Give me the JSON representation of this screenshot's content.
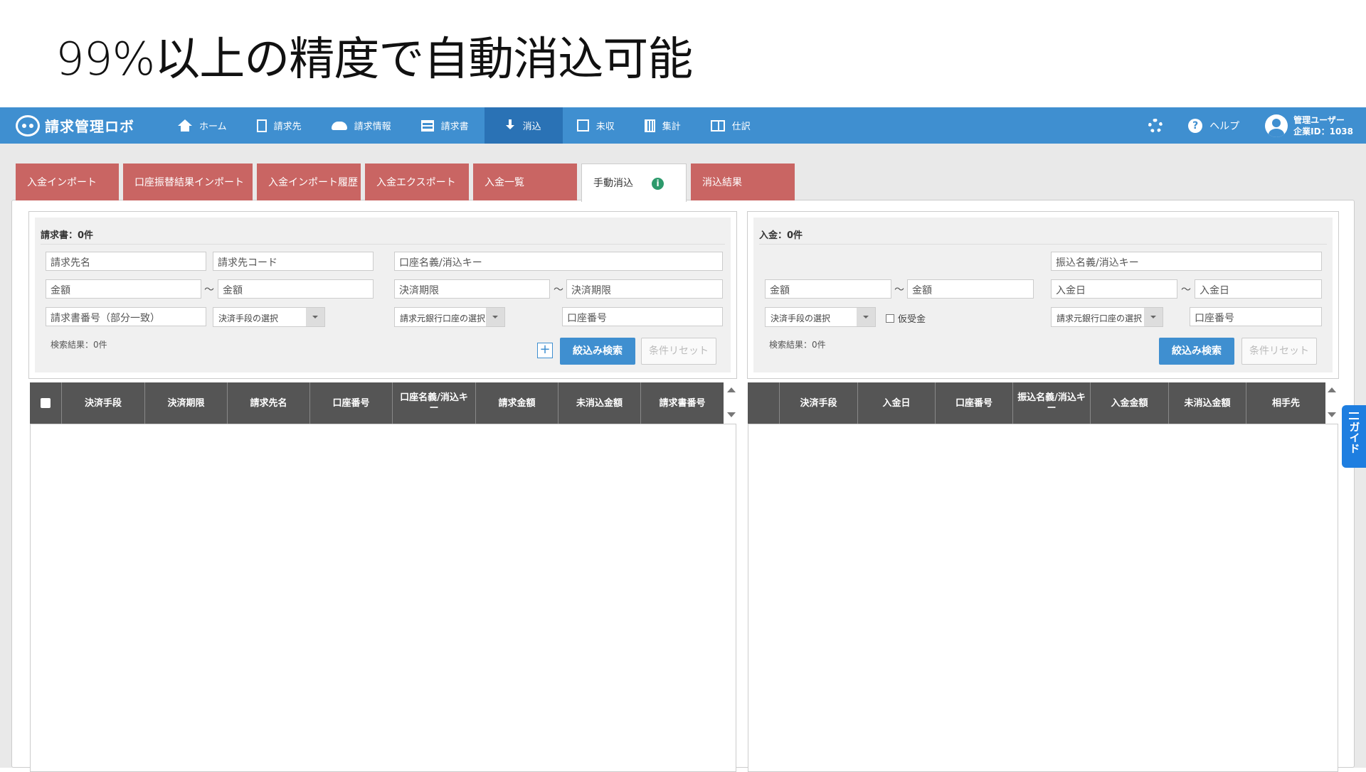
{
  "slide": {
    "title": "99%以上の精度で自動消込可能"
  },
  "app": {
    "brand": "請求管理ロボ",
    "nav": [
      {
        "label": "ホーム",
        "icon": "home-icon"
      },
      {
        "label": "請求先",
        "icon": "building-icon"
      },
      {
        "label": "請求情報",
        "icon": "cloud-icon"
      },
      {
        "label": "請求書",
        "icon": "list-icon"
      },
      {
        "label": "消込",
        "icon": "download-icon",
        "active": true
      },
      {
        "label": "未収",
        "icon": "checkbox-icon"
      },
      {
        "label": "集計",
        "icon": "calculator-icon"
      },
      {
        "label": "仕訳",
        "icon": "book-icon"
      }
    ],
    "help": "ヘルプ",
    "user": {
      "name": "管理ユーザー",
      "company": "企業ID：1038"
    }
  },
  "tabs": [
    {
      "label": "入金インポート"
    },
    {
      "label": "口座振替結果インポート"
    },
    {
      "label": "入金インポート履歴"
    },
    {
      "label": "入金エクスポート"
    },
    {
      "label": "入金一覧"
    },
    {
      "label": "手動消込",
      "active": true
    },
    {
      "label": "消込結果"
    }
  ],
  "left": {
    "header": "請求書：0件",
    "fields": {
      "billing_name": "請求先名",
      "billing_code": "請求先コード",
      "account_key": "口座名義/消込キー",
      "amount_from": "金額",
      "amount_to": "金額",
      "due_from": "決済期限",
      "due_to": "決済期限",
      "invoice_no": "請求書番号（部分一致）",
      "payment_method": "決済手段の選択",
      "bank_account": "請求元銀行口座の選択",
      "account_no": "口座番号"
    },
    "result": "検索結果：0件",
    "search_btn": "絞込み検索",
    "reset_btn": "条件リセット",
    "plus": "+",
    "columns": [
      "決済手段",
      "決済期限",
      "請求先名",
      "口座番号",
      "口座名義/消込キー",
      "請求金額",
      "未消込金額",
      "請求書番号"
    ]
  },
  "right": {
    "header": "入金：0件",
    "fields": {
      "transfer_key": "振込名義/消込キー",
      "amount_from": "金額",
      "amount_to": "金額",
      "date_from": "入金日",
      "date_to": "入金日",
      "payment_method": "決済手段の選択",
      "temp_receipt": "仮受金",
      "bank_account": "請求元銀行口座の選択",
      "account_no": "口座番号"
    },
    "result": "検索結果：0件",
    "search_btn": "絞込み検索",
    "reset_btn": "条件リセット",
    "columns": [
      "決済手段",
      "入金日",
      "口座番号",
      "振込名義/消込キー",
      "入金金額",
      "未消込金額",
      "相手先"
    ]
  },
  "guide": "ガイド",
  "tilde": "～",
  "colors": {
    "nav": "#3f8fd0",
    "nav_active": "#2a72b5",
    "tab": "#c96563",
    "header": "#555555",
    "guide": "#1e7ee0"
  }
}
